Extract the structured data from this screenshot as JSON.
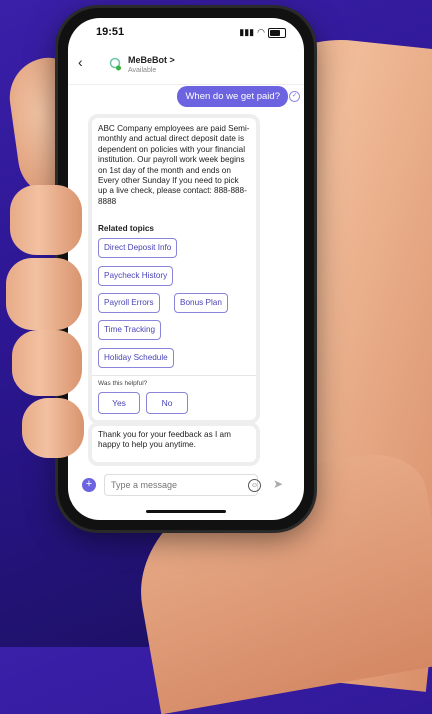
{
  "status": {
    "time": "19:51",
    "battery_label": "81"
  },
  "header": {
    "back_icon": "chevron-left-icon",
    "bot_name": "MeBeBot >",
    "bot_status": "Available"
  },
  "user_message": "When do we get paid?",
  "bot_answer": "ABC Company employees are paid Semi-monthly and actual direct deposit date is dependent on policies with your financial institution. Our payroll work week begins on 1st day of the month and ends on Every other Sunday If you need to pick up a live check, please contact:  888-888-8888",
  "related": {
    "title": "Related topics",
    "chips": [
      "Direct Deposit Info",
      "Paycheck History",
      "Payroll Errors",
      "Bonus Plan",
      "Time Tracking",
      "Holiday Schedule"
    ]
  },
  "feedback": {
    "question": "Was this helpful?",
    "yes": "Yes",
    "no": "No"
  },
  "bot_followup": "Thank you for your feedback as I am happy to help you anytime.",
  "composer": {
    "placeholder": "Type a message"
  },
  "colors": {
    "accent": "#6c63e0",
    "chip_text": "#4a44b8",
    "background": "#2b1690"
  }
}
